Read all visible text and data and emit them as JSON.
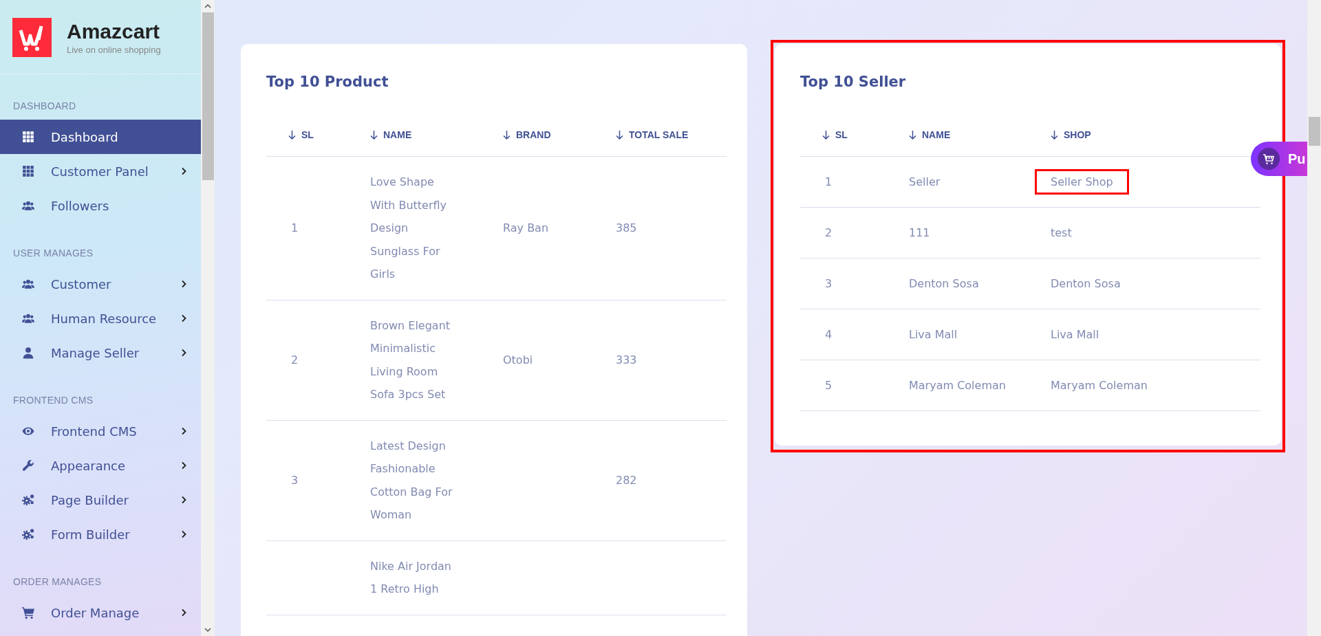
{
  "brand": {
    "name": "Amazcart",
    "tagline": "Live on online shopping"
  },
  "sidebar": {
    "sections": [
      {
        "title": "DASHBOARD",
        "items": [
          {
            "label": "Dashboard",
            "kind": "grid",
            "selected": true,
            "has_submenu": false
          },
          {
            "label": "Customer Panel",
            "kind": "grid",
            "selected": false,
            "has_submenu": true
          },
          {
            "label": "Followers",
            "kind": "users",
            "selected": false,
            "has_submenu": false
          }
        ]
      },
      {
        "title": "USER MANAGES",
        "items": [
          {
            "label": "Customer",
            "kind": "users",
            "selected": false,
            "has_submenu": true
          },
          {
            "label": "Human Resource",
            "kind": "users",
            "selected": false,
            "has_submenu": true
          },
          {
            "label": "Manage Seller",
            "kind": "user",
            "selected": false,
            "has_submenu": true
          }
        ]
      },
      {
        "title": "FRONTEND CMS",
        "items": [
          {
            "label": "Frontend CMS",
            "kind": "eye",
            "selected": false,
            "has_submenu": true
          },
          {
            "label": "Appearance",
            "kind": "wrench",
            "selected": false,
            "has_submenu": true
          },
          {
            "label": "Page Builder",
            "kind": "gears",
            "selected": false,
            "has_submenu": true
          },
          {
            "label": "Form Builder",
            "kind": "gears",
            "selected": false,
            "has_submenu": true
          }
        ]
      },
      {
        "title": "ORDER MANAGES",
        "items": [
          {
            "label": "Order Manage",
            "kind": "cart",
            "selected": false,
            "has_submenu": true
          }
        ]
      }
    ]
  },
  "product_table": {
    "title": "Top 10 Product",
    "columns": [
      "SL",
      "NAME",
      "BRAND",
      "TOTAL SALE"
    ],
    "rows": [
      {
        "sl": "1",
        "name": "Love Shape With Butterfly Design Sunglass For Girls",
        "brand": "Ray Ban",
        "total_sale": "385"
      },
      {
        "sl": "2",
        "name": "Brown Elegant Minimalistic Living Room Sofa 3pcs Set",
        "brand": "Otobi",
        "total_sale": "333"
      },
      {
        "sl": "3",
        "name": "Latest Design Fashionable Cotton Bag For Woman",
        "total_sale": "282"
      },
      {
        "name": "Nike Air Jordan 1 Retro High"
      }
    ]
  },
  "seller_table": {
    "title": "Top 10 Seller",
    "highlighted": true,
    "columns": [
      "SL",
      "NAME",
      "SHOP"
    ],
    "rows": [
      {
        "sl": "1",
        "name": "Seller",
        "shop": "Seller Shop",
        "shop_highlighted": true
      },
      {
        "sl": "2",
        "name": "111",
        "shop": "test",
        "shop_highlighted": false
      },
      {
        "sl": "3",
        "name": "Denton Sosa",
        "shop": "Denton Sosa",
        "shop_highlighted": false
      },
      {
        "sl": "4",
        "name": "Liva Mall",
        "shop": "Liva Mall",
        "shop_highlighted": false
      },
      {
        "sl": "5",
        "name": "Maryam Coleman",
        "shop": "Maryam Coleman",
        "shop_highlighted": false
      }
    ]
  },
  "floating_button": {
    "label": "Pu"
  }
}
